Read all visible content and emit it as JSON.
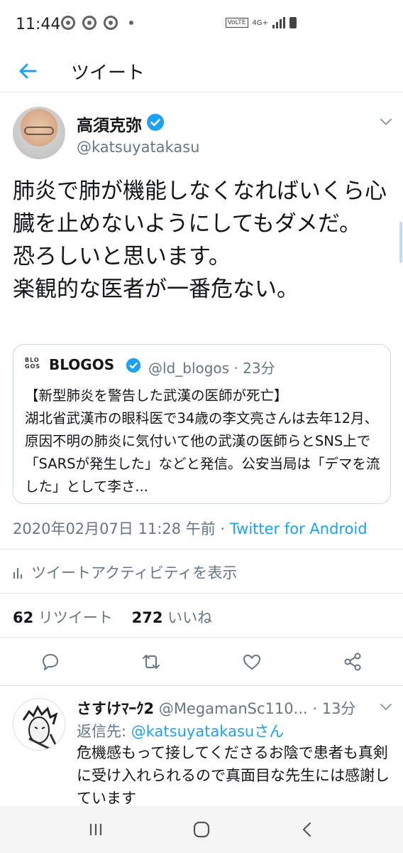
{
  "status_bar": {
    "time": "11:44",
    "network": "4G+",
    "volte": "VoLTE"
  },
  "app_bar": {
    "title": "ツイート"
  },
  "tweet": {
    "author_name": "高須克弥",
    "author_handle": "@katsuyatakasu",
    "text": "肺炎で肺が機能しなくなればいくら心臓を止めないようにしてもダメだ。\n恐ろしいと思います。\n楽観的な医者が一番危ない。",
    "quote": {
      "logo_top": "BLO",
      "logo_bottom": "GOS",
      "name": "BLOGOS",
      "handle_time": "@ld_blogos · 23分",
      "text": "【新型肺炎を警告した武漢の医師が死亡】\n湖北省武漢市の眼科医で34歳の李文亮さんは去年12月、原因不明の肺炎に気付いて他の武漢の医師らとSNS上で「SARSが発生した」などと発信。公安当局は「デマを流した」として李さ..."
    },
    "timestamp": "2020年02月07日 11:28 午前 · ",
    "source": "Twitter for Android",
    "activity_label": "ツイートアクティビティを表示",
    "retweet_count": "62",
    "retweet_label": "リツイート",
    "like_count": "272",
    "like_label": "いいね"
  },
  "reply": {
    "name": "さすけﾏｰｸ2",
    "handle": "@MegamanSc110...",
    "time": "· 13分",
    "reply_to_prefix": "返信先: ",
    "reply_to_mention": "@katsuyatakasuさん",
    "text": "危機感もって接してくださるお陰で患者も真剣に受け入れられるので真面目な先生には感謝しています"
  },
  "colors": {
    "accent": "#1da1f2",
    "secondary_text": "#657786",
    "primary_text": "#14171a",
    "divider": "#e1e8ed"
  },
  "icons": [
    "back-arrow-icon",
    "verified-badge-icon",
    "chevron-down-icon",
    "bar-chart-icon",
    "reply-icon",
    "retweet-icon",
    "like-icon",
    "share-icon",
    "recents-icon",
    "home-icon",
    "back-icon"
  ]
}
